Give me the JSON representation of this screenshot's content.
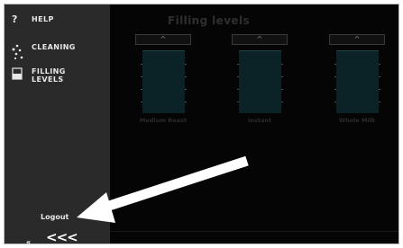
{
  "sidebar": {
    "items": [
      {
        "icon": "question-icon",
        "label": "HELP"
      },
      {
        "icon": "drops-icon",
        "label": "CLEANING"
      },
      {
        "icon": "container-icon",
        "label": "FILLING\nLEVELS"
      }
    ],
    "logout": "Logout",
    "back": "<<<",
    "collapse": "«"
  },
  "main": {
    "title": "Filling levels",
    "levels": [
      {
        "name": "Medium Roast",
        "up": "^"
      },
      {
        "name": "Instant",
        "up": "^"
      },
      {
        "name": "Whole Milk",
        "up": "^"
      }
    ]
  },
  "colors": {
    "sidebar": "#2a2a2a",
    "tank": "#0b2326",
    "arrow": "#ffffff"
  }
}
